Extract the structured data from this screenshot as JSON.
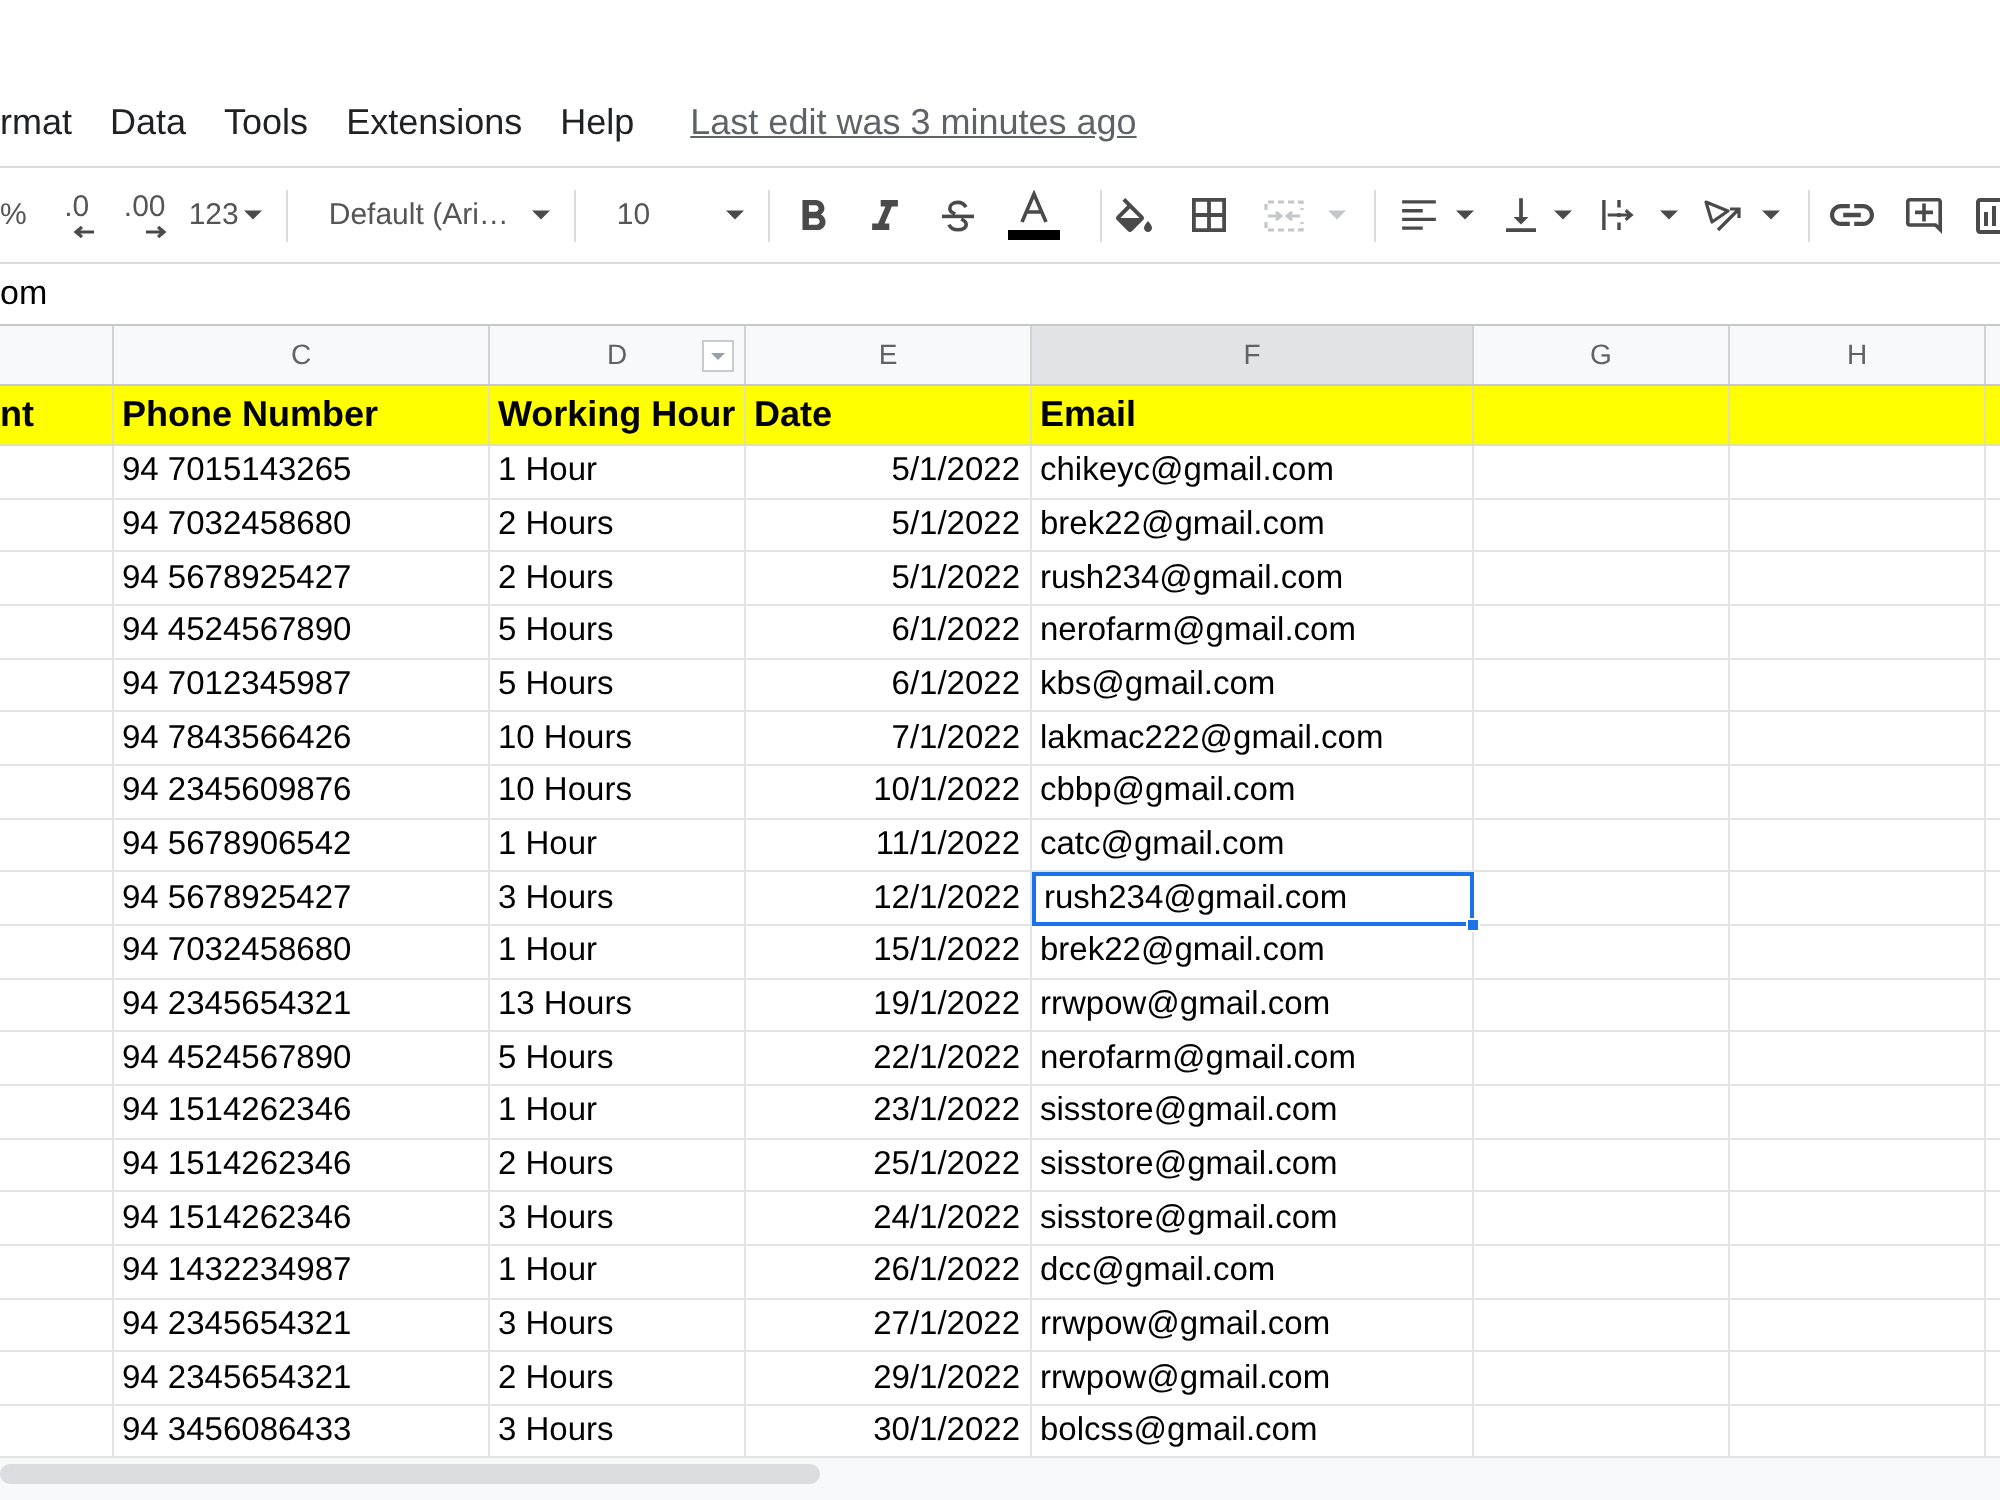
{
  "menu": {
    "items": [
      "rmat",
      "Data",
      "Tools",
      "Extensions",
      "Help"
    ],
    "last_edit": "Last edit was 3 minutes ago"
  },
  "toolbar": {
    "percent": "%",
    "decrease_decimal": ".0",
    "increase_decimal": ".00",
    "number_format": "123",
    "font": "Default (Ari…",
    "font_size": "10",
    "merge_disabled": true
  },
  "formula_bar": {
    "value": "om"
  },
  "sheet": {
    "columns": [
      {
        "selected": false,
        "menu_button": false
      },
      {
        "letter": "C",
        "selected": false,
        "menu_button": false
      },
      {
        "letter": "D",
        "selected": false,
        "menu_button": true
      },
      {
        "letter": "E",
        "selected": false,
        "menu_button": false
      },
      {
        "letter": "F",
        "selected": true,
        "menu_button": false
      },
      {
        "letter": "G",
        "selected": false,
        "menu_button": false
      },
      {
        "letter": "H",
        "selected": false,
        "menu_button": false
      },
      {
        "selected": false,
        "menu_button": false
      }
    ],
    "header_row": [
      "nt",
      "Phone Number",
      "Working Hour",
      "Date",
      "Email"
    ],
    "rows": [
      {
        "cells": [
          "",
          "94 7015143265",
          "1 Hour",
          "5/1/2022",
          "chikeyc@gmail.com"
        ],
        "selected": false
      },
      {
        "cells": [
          "",
          "94 7032458680",
          "2 Hours",
          "5/1/2022",
          "brek22@gmail.com"
        ],
        "selected": false
      },
      {
        "cells": [
          "",
          "94 5678925427",
          "2 Hours",
          "5/1/2022",
          "rush234@gmail.com"
        ],
        "selected": false
      },
      {
        "cells": [
          "",
          "94 4524567890",
          "5 Hours",
          "6/1/2022",
          "nerofarm@gmail.com"
        ],
        "selected": false
      },
      {
        "cells": [
          "",
          "94 7012345987",
          "5 Hours",
          "6/1/2022",
          "kbs@gmail.com"
        ],
        "selected": false
      },
      {
        "cells": [
          "",
          "94 7843566426",
          "10 Hours",
          "7/1/2022",
          "lakmac222@gmail.com"
        ],
        "selected": false
      },
      {
        "cells": [
          "",
          "94 2345609876",
          "10 Hours",
          "10/1/2022",
          "cbbp@gmail.com"
        ],
        "selected": false
      },
      {
        "cells": [
          "",
          "94 5678906542",
          "1 Hour",
          "11/1/2022",
          "catc@gmail.com"
        ],
        "selected": false
      },
      {
        "cells": [
          "",
          "94 5678925427",
          "3 Hours",
          "12/1/2022",
          "rush234@gmail.com"
        ],
        "selected": true
      },
      {
        "cells": [
          "",
          "94 7032458680",
          "1 Hour",
          "15/1/2022",
          "brek22@gmail.com"
        ],
        "selected": false
      },
      {
        "cells": [
          "",
          "94 2345654321",
          "13 Hours",
          "19/1/2022",
          "rrwpow@gmail.com"
        ],
        "selected": false
      },
      {
        "cells": [
          "",
          "94 4524567890",
          "5 Hours",
          "22/1/2022",
          "nerofarm@gmail.com"
        ],
        "selected": false
      },
      {
        "cells": [
          "",
          "94 1514262346",
          "1 Hour",
          "23/1/2022",
          "sisstore@gmail.com"
        ],
        "selected": false
      },
      {
        "cells": [
          "",
          "94 1514262346",
          "2 Hours",
          "25/1/2022",
          "sisstore@gmail.com"
        ],
        "selected": false
      },
      {
        "cells": [
          "",
          "94 1514262346",
          "3 Hours",
          "24/1/2022",
          "sisstore@gmail.com"
        ],
        "selected": false
      },
      {
        "cells": [
          "",
          "94 1432234987",
          "1 Hour",
          "26/1/2022",
          "dcc@gmail.com"
        ],
        "selected": false
      },
      {
        "cells": [
          "",
          "94 2345654321",
          "3 Hours",
          "27/1/2022",
          "rrwpow@gmail.com"
        ],
        "selected": false
      },
      {
        "cells": [
          "",
          "94 2345654321",
          "2 Hours",
          "29/1/2022",
          "rrwpow@gmail.com"
        ],
        "selected": false
      },
      {
        "cells": [
          "",
          "94 3456086433",
          "3 Hours",
          "30/1/2022",
          "bolcss@gmail.com"
        ],
        "selected": false
      }
    ]
  }
}
